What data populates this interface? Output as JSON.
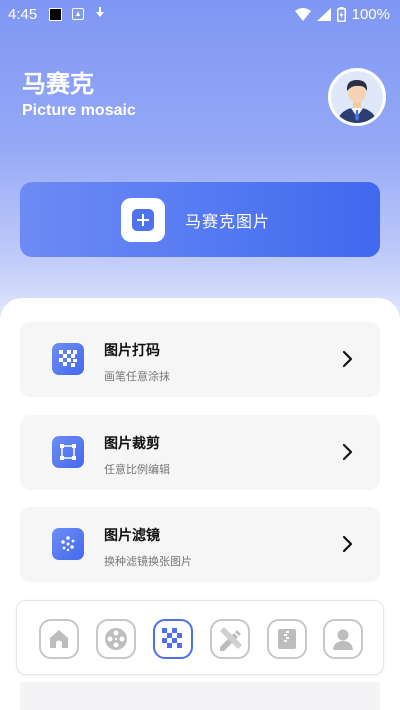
{
  "status_bar": {
    "time": "4:45",
    "battery": "100%"
  },
  "header": {
    "title": "马赛克",
    "subtitle": "Picture mosaic"
  },
  "main_action": {
    "label": "马赛克图片"
  },
  "cards": [
    {
      "title": "图片打码",
      "desc": "画笔任意涂抹",
      "icon": "mosaic-icon"
    },
    {
      "title": "图片裁剪",
      "desc": "任意比例编辑",
      "icon": "crop-icon"
    },
    {
      "title": "图片滤镜",
      "desc": "换种滤镜换张图片",
      "icon": "filter-icon"
    }
  ],
  "nav": [
    {
      "icon": "home-icon",
      "active": false
    },
    {
      "icon": "film-reel-icon",
      "active": false
    },
    {
      "icon": "mosaic-icon",
      "active": true
    },
    {
      "icon": "pencil-ruler-icon",
      "active": false
    },
    {
      "icon": "archive-icon",
      "active": false
    },
    {
      "icon": "profile-icon",
      "active": false
    }
  ],
  "colors": {
    "accent": "#4d6ff0",
    "hero_top": "#7f97f4"
  }
}
